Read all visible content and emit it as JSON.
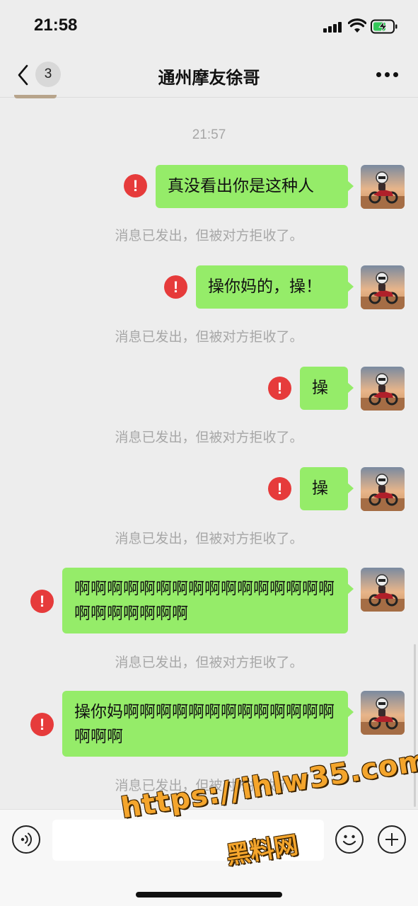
{
  "status_bar": {
    "time": "21:58"
  },
  "nav": {
    "back_count": "3",
    "title": "通州摩友徐哥"
  },
  "chat": {
    "timestamp": "21:57",
    "messages": [
      {
        "text": "真没看出你是这种人",
        "notice": "消息已发出，但被对方拒收了。"
      },
      {
        "text": "操你妈的，操！",
        "notice": "消息已发出，但被对方拒收了。"
      },
      {
        "text": "操",
        "notice": "消息已发出，但被对方拒收了。"
      },
      {
        "text": "操",
        "notice": "消息已发出，但被对方拒收了。"
      },
      {
        "text": "啊啊啊啊啊啊啊啊啊啊啊啊啊啊啊啊啊啊啊啊啊啊啊",
        "notice": "消息已发出，但被对方拒收了。"
      },
      {
        "text": "操你妈啊啊啊啊啊啊啊啊啊啊啊啊啊啊啊啊",
        "notice": "消息已发出，但被对方拒收了。"
      }
    ],
    "error_icon": "exclamation-circle-icon",
    "bubble_color": "#95ec69",
    "error_color": "#e63b3b"
  },
  "watermark": {
    "url": "https://ihlw35.com",
    "name": "黑料网"
  }
}
